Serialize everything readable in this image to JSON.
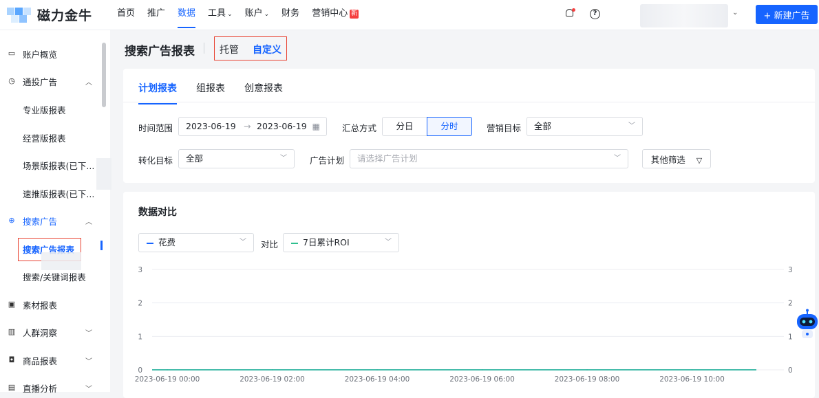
{
  "header": {
    "app_name": "磁力金牛",
    "nav": [
      {
        "label": "首页"
      },
      {
        "label": "推广"
      },
      {
        "label": "数据",
        "active": true
      },
      {
        "label": "工具",
        "caret": "⌄"
      },
      {
        "label": "账户",
        "caret": "⌄"
      },
      {
        "label": "财务"
      },
      {
        "label": "营销中心",
        "badge": "新"
      }
    ],
    "help_icon": "?",
    "new_ad_button": "+ 新建广告",
    "accent_color": "#1664ff",
    "badge_color": "#f53f3f"
  },
  "sidebar": {
    "items": [
      {
        "label": "账户概览",
        "icon": "monitor-icon"
      },
      {
        "label": "通投广告",
        "icon": "clock-icon",
        "arrow": "⌃"
      },
      {
        "label": "专业版报表",
        "sub": true
      },
      {
        "label": "经营版报表",
        "sub": true
      },
      {
        "label": "场景版报表(已下...",
        "sub": true
      },
      {
        "label": "速推版报表(已下...",
        "sub": true
      },
      {
        "label": "搜索广告",
        "icon": "search-plus-icon",
        "arrow": "⌃",
        "active": true
      },
      {
        "label": "搜索广告报表",
        "sub": true,
        "active": true
      },
      {
        "label": "搜索/关键词报表",
        "sub": true
      },
      {
        "label": "素材报表",
        "icon": "images-icon"
      },
      {
        "label": "人群洞察",
        "icon": "bar-chart-icon",
        "arrow": "⌄"
      },
      {
        "label": "商品报表",
        "icon": "bag-icon",
        "arrow": "⌄"
      },
      {
        "label": "直播分析",
        "icon": "tv-icon",
        "arrow": "⌄"
      }
    ]
  },
  "page": {
    "title": "搜索广告报表",
    "modes": [
      "托管",
      "自定义"
    ],
    "active_mode": "自定义",
    "tabs": [
      "计划报表",
      "组报表",
      "创意报表"
    ],
    "active_tab": "计划报表"
  },
  "filters": {
    "time_range_label": "时间范围",
    "start_date": "2023-06-19",
    "date_sep": "→",
    "end_date": "2023-06-19",
    "summary_label": "汇总方式",
    "summary_options": [
      "分日",
      "分时"
    ],
    "summary_selected": "分时",
    "marketing_goal_label": "营销目标",
    "marketing_goal_value": "全部",
    "conversion_goal_label": "转化目标",
    "conversion_goal_value": "全部",
    "ad_plan_label": "广告计划",
    "ad_plan_placeholder": "请选择广告计划",
    "other_filter_button": "其他筛选"
  },
  "comparison": {
    "title": "数据对比",
    "metric_a": "花费",
    "compare_label": "对比",
    "metric_b": "7日累计ROI"
  },
  "chart_data": {
    "type": "line",
    "x": [
      "2023-06-19 00:00",
      "2023-06-19 02:00",
      "2023-06-19 04:00",
      "2023-06-19 06:00",
      "2023-06-19 08:00",
      "2023-06-19 10:00"
    ],
    "y_ticks_left": [
      "3",
      "2",
      "1",
      "0"
    ],
    "y_ticks_right": [
      "3",
      "2",
      "1",
      "0"
    ],
    "ylim": [
      0,
      3
    ],
    "series": [
      {
        "name": "花费",
        "color": "#1664ff",
        "values": [
          0,
          0,
          0,
          0,
          0,
          0
        ]
      },
      {
        "name": "7日累计ROI",
        "color": "#2fbf8f",
        "values": [
          0,
          0,
          0,
          0,
          0,
          0
        ]
      }
    ],
    "grid": true
  }
}
